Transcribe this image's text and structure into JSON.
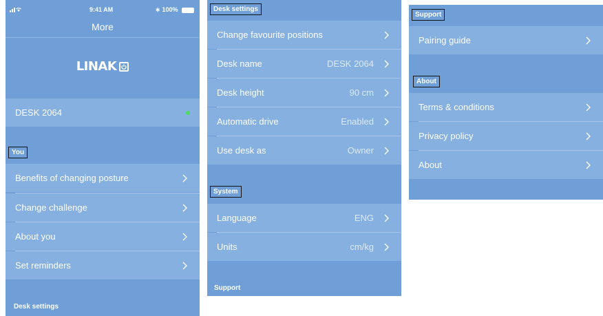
{
  "status_bar": {
    "time": "9:41 AM",
    "battery": "100%"
  },
  "panel1": {
    "title": "More",
    "logo": "LINAK",
    "desk_item": {
      "label": "DESK 2064"
    },
    "you_header": "You",
    "you_items": [
      {
        "label": "Benefits of changing posture"
      },
      {
        "label": "Change challenge"
      },
      {
        "label": "About you"
      },
      {
        "label": "Set reminders"
      }
    ],
    "bottom_header": "Desk settings"
  },
  "panel2": {
    "desk_settings_header": "Desk settings",
    "desk_items": [
      {
        "label": "Change favourite positions",
        "value": ""
      },
      {
        "label": "Desk name",
        "value": "DESK 2064"
      },
      {
        "label": "Desk height",
        "value": "90 cm"
      },
      {
        "label": "Automatic drive",
        "value": "Enabled"
      },
      {
        "label": "Use desk as",
        "value": "Owner"
      }
    ],
    "system_header": "System",
    "system_items": [
      {
        "label": "Language",
        "value": "ENG"
      },
      {
        "label": "Units",
        "value": "cm/kg"
      }
    ],
    "support_header": "Support"
  },
  "panel3": {
    "support_header": "Support",
    "support_items": [
      {
        "label": "Pairing guide"
      }
    ],
    "about_header": "About",
    "about_items": [
      {
        "label": "Terms & conditions"
      },
      {
        "label": "Privacy policy"
      },
      {
        "label": "About"
      }
    ]
  },
  "colors": {
    "background": "#6f9fd6",
    "row": "#86b0df",
    "status_dot": "#4cd964"
  }
}
